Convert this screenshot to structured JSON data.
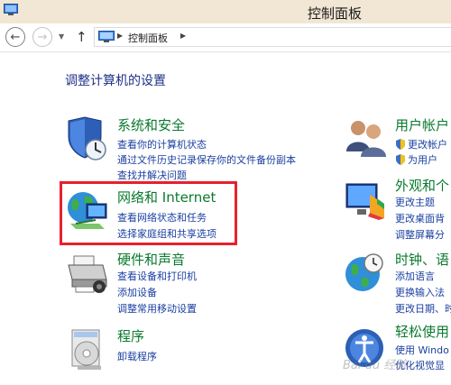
{
  "window": {
    "title": "控制面板"
  },
  "nav": {
    "back_glyph": "←",
    "forward_glyph": "→",
    "dropdown_glyph": "▼",
    "up_glyph": "↑",
    "address_path": "控制面板",
    "separator_glyph": "▶"
  },
  "heading": "调整计算机的设置",
  "categories": [
    {
      "title": "系统和安全",
      "icon": "system-security-icon",
      "links": [
        "查看你的计算机状态",
        "通过文件历史记录保存你的文件备份副本",
        "查找并解决问题"
      ]
    },
    {
      "title": "网络和 Internet",
      "icon": "network-internet-icon",
      "links": [
        "查看网络状态和任务",
        "选择家庭组和共享选项"
      ]
    },
    {
      "title": "硬件和声音",
      "icon": "hardware-sound-icon",
      "links": [
        "查看设备和打印机",
        "添加设备",
        "调整常用移动设置"
      ]
    },
    {
      "title": "程序",
      "icon": "programs-icon",
      "links": [
        "卸载程序"
      ]
    },
    {
      "title": "用户帐户",
      "icon": "user-accounts-icon",
      "links": [
        "更改帐户",
        "为用户"
      ]
    },
    {
      "title": "外观和个",
      "icon": "appearance-icon",
      "links": [
        "更改主题",
        "更改桌面背",
        "调整屏幕分"
      ]
    },
    {
      "title": "时钟、语",
      "icon": "clock-region-icon",
      "links": [
        "添加语言",
        "更换输入法",
        "更改日期、时"
      ]
    },
    {
      "title": "轻松使用",
      "icon": "ease-of-access-icon",
      "links": [
        "使用 Windo",
        "优化视觉显"
      ]
    }
  ],
  "watermark": "Bai du 经验",
  "colors": {
    "highlight": "#e8202c",
    "category_title": "#0a7a2e",
    "link": "#1a3fa0",
    "heading": "#1e3287"
  }
}
